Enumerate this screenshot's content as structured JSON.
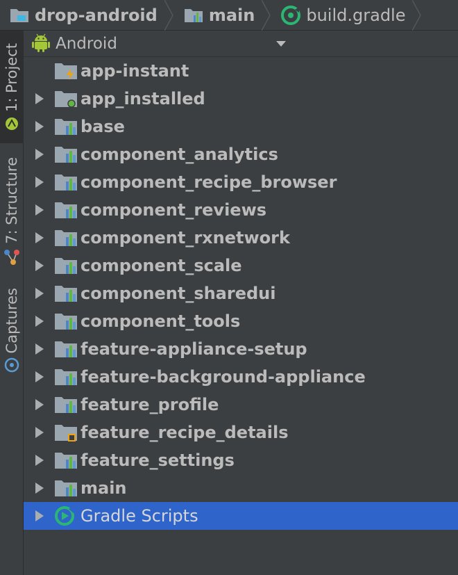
{
  "breadcrumb": {
    "items": [
      {
        "label": "drop-android",
        "icon": "project-folder-icon"
      },
      {
        "label": "main",
        "icon": "module-folder-icon"
      },
      {
        "label": "build.gradle",
        "icon": "gradle-icon"
      }
    ]
  },
  "tool_strip": {
    "tabs": [
      {
        "label": "1: Project",
        "icon": "android-icon",
        "active": true
      },
      {
        "label": "7: Structure",
        "icon": "structure-icon",
        "active": false
      },
      {
        "label": "Captures",
        "icon": "captures-icon",
        "active": false
      }
    ]
  },
  "panel": {
    "view_selector": {
      "label": "Android",
      "icon": "android-icon"
    }
  },
  "tree": {
    "items": [
      {
        "label": "app-instant",
        "icon": "instant-app-folder-icon",
        "expandable": false
      },
      {
        "label": "app_installed",
        "icon": "app-module-folder-icon",
        "expandable": true
      },
      {
        "label": "base",
        "icon": "module-folder-icon",
        "expandable": true
      },
      {
        "label": "component_analytics",
        "icon": "module-folder-icon",
        "expandable": true
      },
      {
        "label": "component_recipe_browser",
        "icon": "module-folder-icon",
        "expandable": true
      },
      {
        "label": "component_reviews",
        "icon": "module-folder-icon",
        "expandable": true
      },
      {
        "label": "component_rxnetwork",
        "icon": "module-folder-icon",
        "expandable": true
      },
      {
        "label": "component_scale",
        "icon": "module-folder-icon",
        "expandable": true
      },
      {
        "label": "component_sharedui",
        "icon": "module-folder-icon",
        "expandable": true
      },
      {
        "label": "component_tools",
        "icon": "module-folder-icon",
        "expandable": true
      },
      {
        "label": "feature-appliance-setup",
        "icon": "module-folder-icon",
        "expandable": true
      },
      {
        "label": "feature-background-appliance",
        "icon": "module-folder-icon",
        "expandable": true
      },
      {
        "label": "feature_profile",
        "icon": "module-folder-icon",
        "expandable": true
      },
      {
        "label": "feature_recipe_details",
        "icon": "feature-module-folder-icon",
        "expandable": true
      },
      {
        "label": "feature_settings",
        "icon": "module-folder-icon",
        "expandable": true
      },
      {
        "label": "main",
        "icon": "module-folder-icon",
        "expandable": true
      },
      {
        "label": "Gradle Scripts",
        "icon": "gradle-icon",
        "expandable": true,
        "selected": true
      }
    ]
  },
  "colors": {
    "background": "#3c3f41",
    "selection": "#2f65ca",
    "text": "#bbbbbb",
    "module_bars": [
      "#5b9bd5",
      "#62b543",
      "#4a86c8"
    ],
    "gradle_green": "#2bb673",
    "android_green": "#a4c639"
  }
}
